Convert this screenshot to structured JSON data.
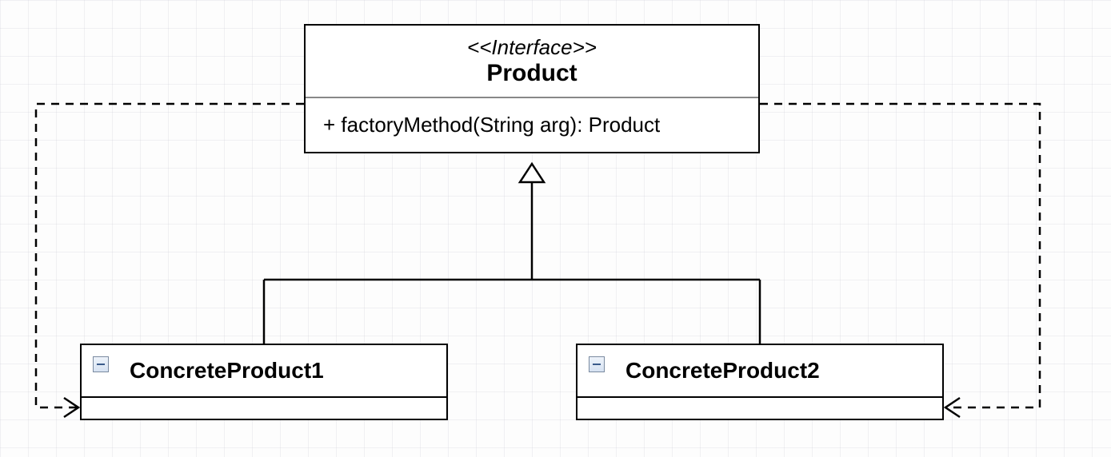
{
  "interface": {
    "stereotype": "<<Interface>>",
    "name": "Product",
    "method": "+ factoryMethod(String arg): Product"
  },
  "subclasses": [
    {
      "name": "ConcreteProduct1"
    },
    {
      "name": "ConcreteProduct2"
    }
  ],
  "chart_data": {
    "type": "uml_class_diagram",
    "nodes": [
      {
        "id": "Product",
        "kind": "interface",
        "stereotype": "Interface",
        "members": [
          "+ factoryMethod(String arg): Product"
        ]
      },
      {
        "id": "ConcreteProduct1",
        "kind": "class"
      },
      {
        "id": "ConcreteProduct2",
        "kind": "class"
      }
    ],
    "edges": [
      {
        "from": "ConcreteProduct1",
        "to": "Product",
        "type": "realization"
      },
      {
        "from": "ConcreteProduct2",
        "to": "Product",
        "type": "realization"
      },
      {
        "from": "Product",
        "to": "ConcreteProduct1",
        "type": "dependency"
      },
      {
        "from": "Product",
        "to": "ConcreteProduct2",
        "type": "dependency"
      }
    ]
  }
}
